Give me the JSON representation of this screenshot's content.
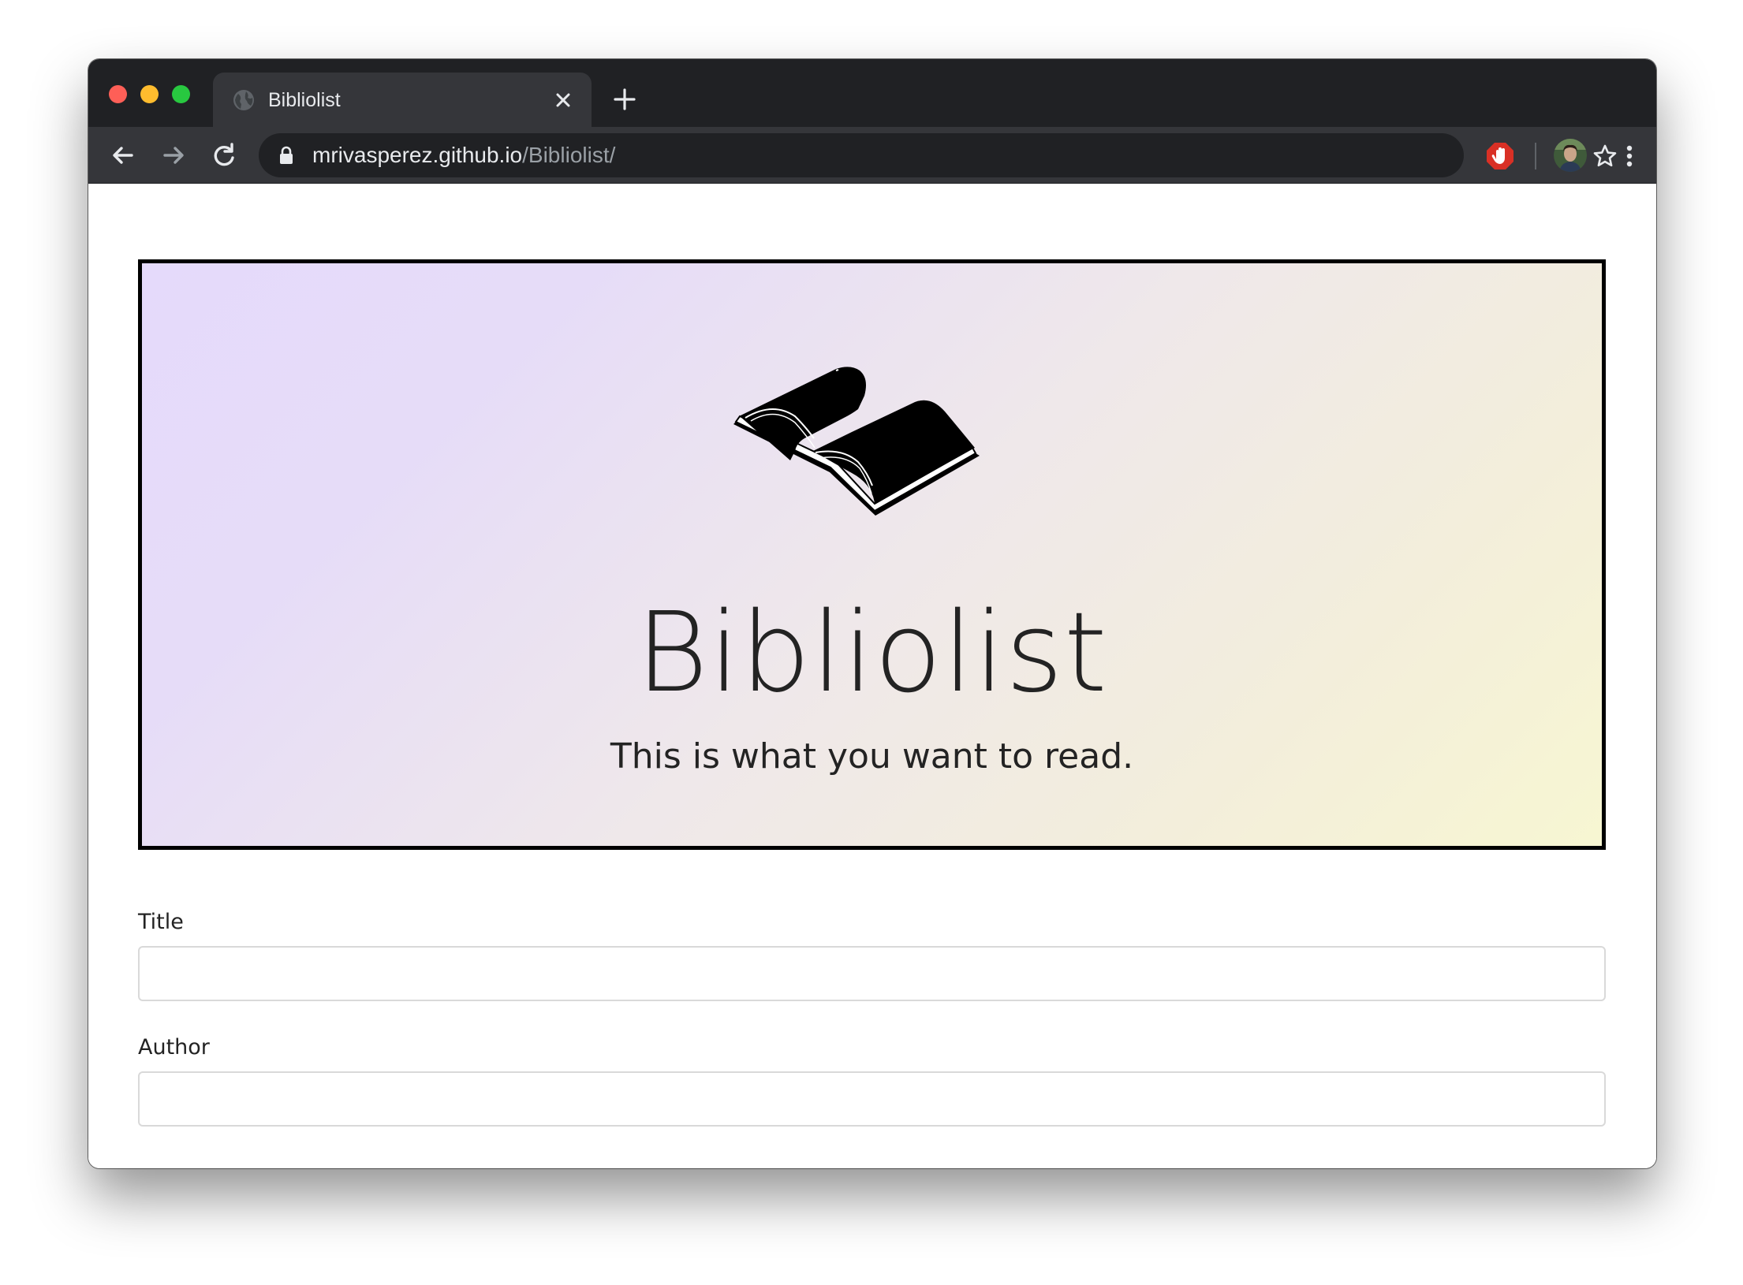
{
  "browser": {
    "tab": {
      "title": "Bibliolist"
    },
    "address_bar": {
      "host": "mrivasperez.github.io",
      "path": "/Bibliolist/"
    },
    "colors": {
      "frame": "#202124",
      "toolbar": "#35363a",
      "extension_accent": "#d93025"
    }
  },
  "hero": {
    "title": "Bibliolist",
    "subtitle": "This is what you want to read.",
    "logo_icon": "open-book-icon",
    "gradient": [
      "#e5dafb",
      "#f7f6d2"
    ]
  },
  "form": {
    "fields": [
      {
        "label": "Title",
        "value": ""
      },
      {
        "label": "Author",
        "value": ""
      }
    ]
  }
}
